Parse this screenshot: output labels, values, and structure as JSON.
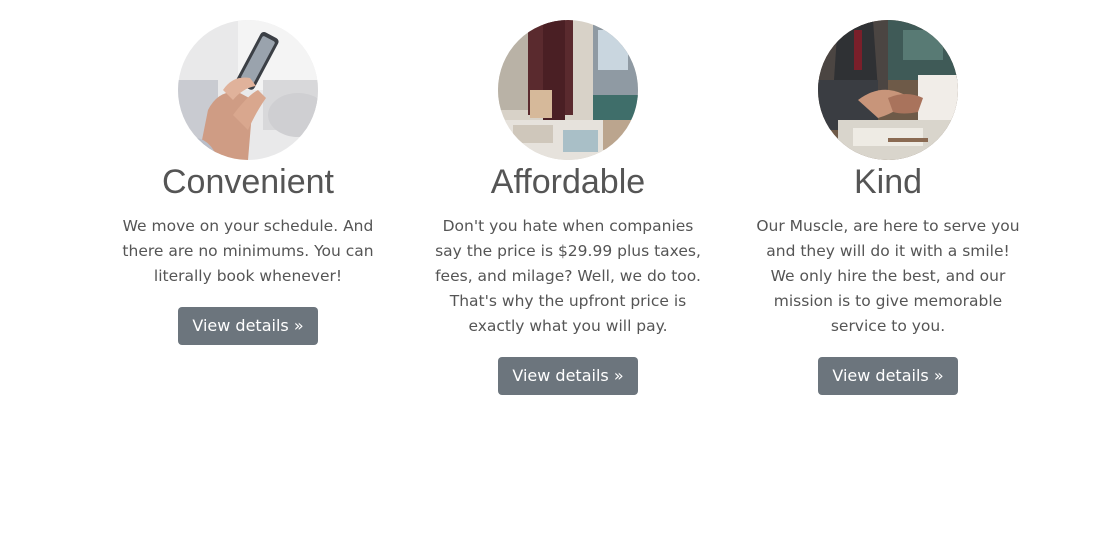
{
  "features": [
    {
      "title": "Convenient",
      "text": "We move on your schedule. And there are no minimums. You can literally book whenever!",
      "button_label": "View details »",
      "image": "phone-in-hand-photo"
    },
    {
      "title": "Affordable",
      "text": "Don't you hate when companies say the price is $29.99 plus taxes, fees, and milage? Well, we do too. That's why the upfront price is exactly what you will pay.",
      "button_label": "View details »",
      "image": "moving-boxes-photo"
    },
    {
      "title": "Kind",
      "text": "Our Muscle, are here to serve you and they will do it with a smile! We only hire the best, and our mission is to give memorable service to you.",
      "button_label": "View details »",
      "image": "handshake-photo"
    }
  ],
  "colors": {
    "button_bg": "#6c757d",
    "button_text": "#ffffff",
    "text": "#555555"
  }
}
